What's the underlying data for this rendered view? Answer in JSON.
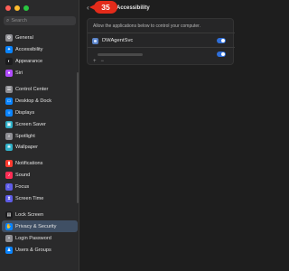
{
  "window": {
    "title": "Accessibility"
  },
  "search": {
    "placeholder": "Search"
  },
  "sidebar": {
    "items": [
      {
        "label": "General",
        "icon": "gear-icon",
        "color": "#8e8e93"
      },
      {
        "label": "Accessibility",
        "icon": "accessibility-icon",
        "color": "#0a84ff"
      },
      {
        "label": "Appearance",
        "icon": "appearance-icon",
        "color": "#1c1c1e"
      },
      {
        "label": "Siri",
        "icon": "siri-icon",
        "color": "#b14cff"
      },
      {
        "label": "Control Center",
        "icon": "control-center-icon",
        "color": "#8e8e93"
      },
      {
        "label": "Desktop & Dock",
        "icon": "dock-icon",
        "color": "#0a84ff"
      },
      {
        "label": "Displays",
        "icon": "display-icon",
        "color": "#0a84ff"
      },
      {
        "label": "Screen Saver",
        "icon": "screen-saver-icon",
        "color": "#30b0c7"
      },
      {
        "label": "Spotlight",
        "icon": "spotlight-icon",
        "color": "#8e8e93"
      },
      {
        "label": "Wallpaper",
        "icon": "wallpaper-icon",
        "color": "#30b0c7"
      },
      {
        "label": "Notifications",
        "icon": "notifications-icon",
        "color": "#ff3b30"
      },
      {
        "label": "Sound",
        "icon": "sound-icon",
        "color": "#ff2d55"
      },
      {
        "label": "Focus",
        "icon": "focus-icon",
        "color": "#5e5ce6"
      },
      {
        "label": "Screen Time",
        "icon": "screen-time-icon",
        "color": "#5e5ce6"
      },
      {
        "label": "Lock Screen",
        "icon": "lock-screen-icon",
        "color": "#1c1c1e"
      },
      {
        "label": "Privacy & Security",
        "icon": "hand-icon",
        "color": "#0a84ff"
      },
      {
        "label": "Login Password",
        "icon": "password-icon",
        "color": "#8e8e93"
      },
      {
        "label": "Users & Groups",
        "icon": "users-icon",
        "color": "#0a84ff"
      }
    ],
    "active_index": 15
  },
  "main": {
    "badge": "35",
    "description": "Allow the applications below to control your computer.",
    "apps": [
      {
        "name": "DWAgentSvc",
        "enabled": true
      },
      {
        "name": "",
        "enabled": true
      }
    ],
    "footer": {
      "add": "+",
      "remove": "−"
    }
  }
}
